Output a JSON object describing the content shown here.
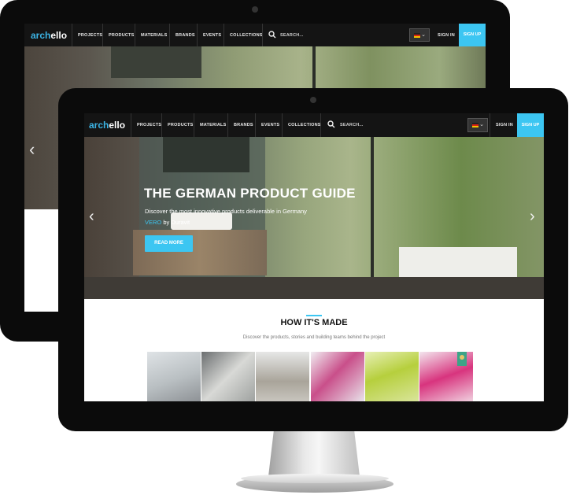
{
  "brand": {
    "logo_prefix": "arch",
    "logo_suffix": "ello"
  },
  "nav": {
    "items": [
      "PROJECTS",
      "PRODUCTS",
      "MATERIALS",
      "BRANDS",
      "EVENTS",
      "COLLECTIONS"
    ],
    "search_label": "SEARCH...",
    "signin_label": "SIGN IN",
    "signup_label": "SIGN UP"
  },
  "hero": {
    "title": "THE GERMAN PRODUCT GUIDE",
    "subtitle": "Discover the most innovative products deliverable in Germany",
    "product_name": "VERO",
    "by_text": " by Duravit",
    "button_label": "READ MORE"
  },
  "section": {
    "title": "HOW IT'S MADE",
    "subtitle": "Discover the products, stories and building teams behind the project"
  },
  "colors": {
    "accent": "#3cc6f2",
    "nav_bg": "#141414",
    "bezel": "#0b0b0b"
  },
  "icons": {
    "search": "search-icon",
    "prev": "chevron-left-icon",
    "next": "chevron-right-icon",
    "flag": "german-flag-icon",
    "dropdown": "chevron-down-icon",
    "award": "award-ribbon-icon"
  }
}
